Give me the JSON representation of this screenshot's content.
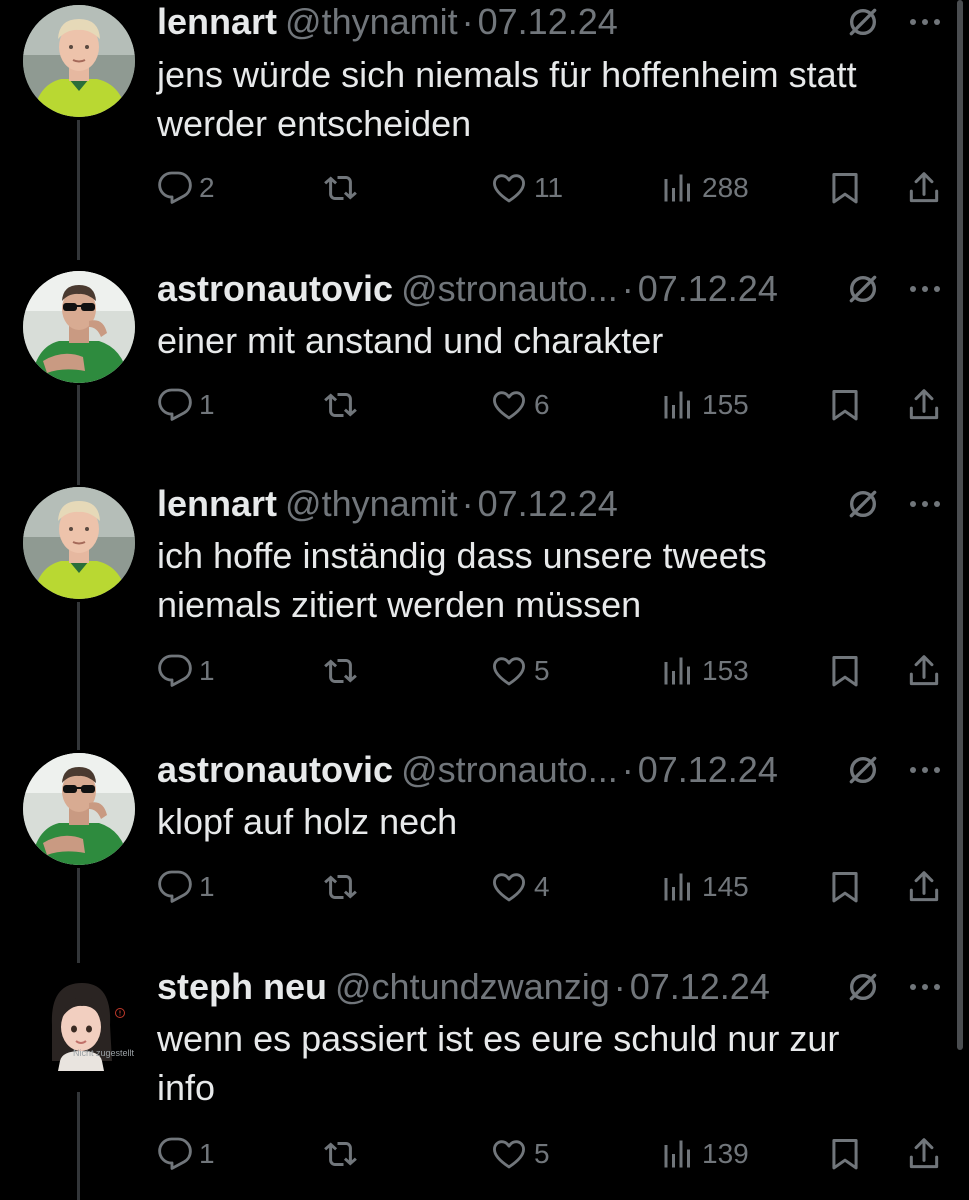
{
  "tweets": [
    {
      "name": "lennart",
      "handle": "@thynamit",
      "date": "07.12.24",
      "text_lines": [
        "jens würde sich niemals für hoffenheim statt",
        "werder entscheiden"
      ],
      "replies": "2",
      "likes": "11",
      "views": "288",
      "avatar": "player-blond"
    },
    {
      "name": "astronautovic",
      "handle": "@stronauto...",
      "date": "07.12.24",
      "text_lines": [
        "einer mit anstand und charakter"
      ],
      "replies": "1",
      "likes": "6",
      "views": "155",
      "avatar": "player-sunglasses"
    },
    {
      "name": "lennart",
      "handle": "@thynamit",
      "date": "07.12.24",
      "text_lines": [
        "ich hoffe inständig dass unsere tweets",
        "niemals zitiert werden müssen"
      ],
      "replies": "1",
      "likes": "5",
      "views": "153",
      "avatar": "player-blond"
    },
    {
      "name": "astronautovic",
      "handle": "@stronauto...",
      "date": "07.12.24",
      "text_lines": [
        "klopf auf holz nech"
      ],
      "replies": "1",
      "likes": "4",
      "views": "145",
      "avatar": "player-sunglasses"
    },
    {
      "name": "steph neu",
      "handle": "@chtundzwanzig",
      "date": "07.12.24",
      "text_lines": [
        "wenn es passiert ist es eure schuld nur zur",
        "info"
      ],
      "replies": "1",
      "likes": "5",
      "views": "139",
      "avatar": "memoji-girl",
      "avatar_caption": "Nicht zugestellt"
    }
  ],
  "separator": "·",
  "colors": {
    "background": "#000000",
    "primary_text": "#e7e9ea",
    "secondary_text": "#71767b",
    "thread_line": "#333639",
    "jersey_green": "#2e8b3e"
  },
  "icons": [
    "reply-icon",
    "retweet-icon",
    "like-icon",
    "views-icon",
    "bookmark-icon",
    "share-icon",
    "grok-icon",
    "more-icon"
  ]
}
